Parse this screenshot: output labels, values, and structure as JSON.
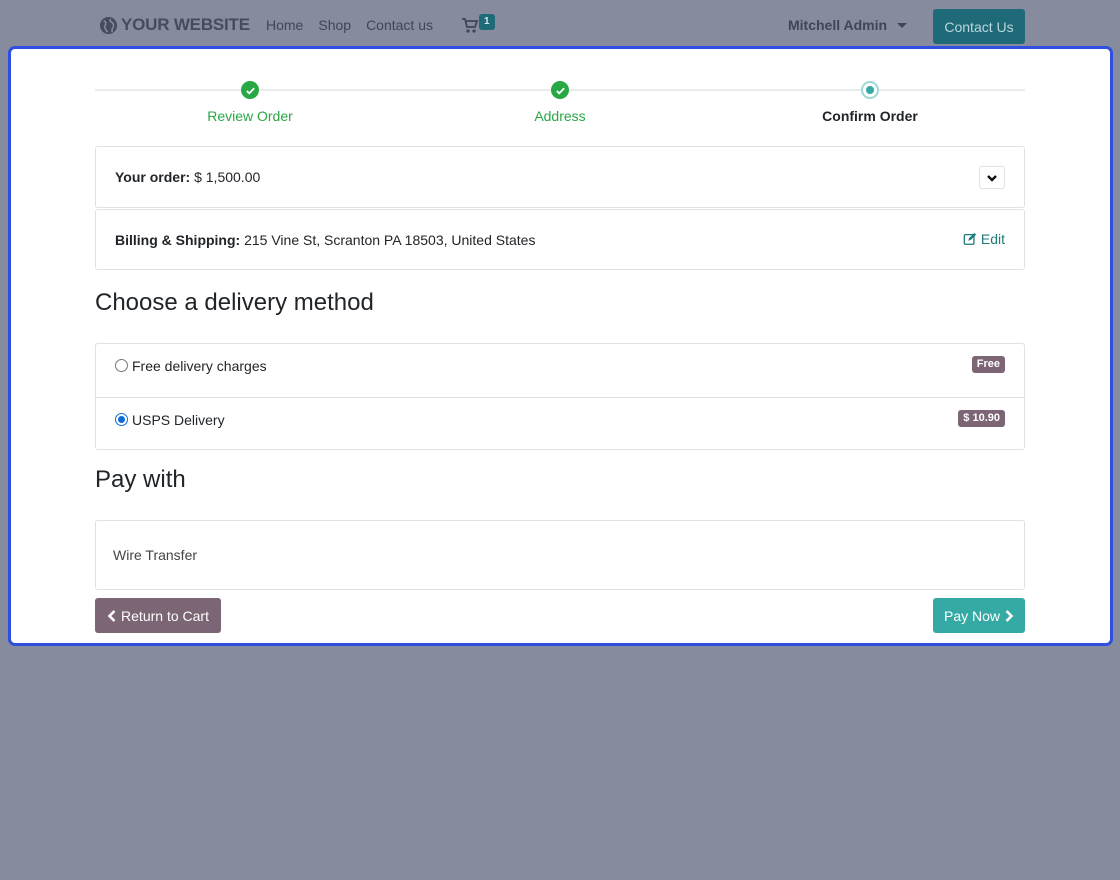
{
  "navbar": {
    "brand": "YOUR WEBSITE",
    "links": [
      "Home",
      "Shop",
      "Contact us"
    ],
    "cart_count": "1",
    "user": "Mitchell Admin",
    "cta": "Contact Us"
  },
  "steps": [
    {
      "label": "Review Order",
      "state": "done"
    },
    {
      "label": "Address",
      "state": "done"
    },
    {
      "label": "Confirm Order",
      "state": "current"
    }
  ],
  "order": {
    "label": "Your order:",
    "amount": "$ 1,500.00"
  },
  "shipping": {
    "label": "Billing & Shipping:",
    "address": "215 Vine St, Scranton PA 18503, United States",
    "edit": "Edit"
  },
  "delivery": {
    "title": "Choose a delivery method",
    "options": [
      {
        "label": "Free delivery charges",
        "price": "Free",
        "selected": false
      },
      {
        "label": "USPS Delivery",
        "price": "$ 10.90",
        "selected": true
      }
    ]
  },
  "payment": {
    "title": "Pay with",
    "method": "Wire Transfer"
  },
  "actions": {
    "back": "Return to Cart",
    "pay": "Pay Now"
  },
  "colors": {
    "success": "#28a745",
    "primary": "#35aaa5",
    "secondary": "#7c6574",
    "modal_border": "#2e4fe0"
  }
}
